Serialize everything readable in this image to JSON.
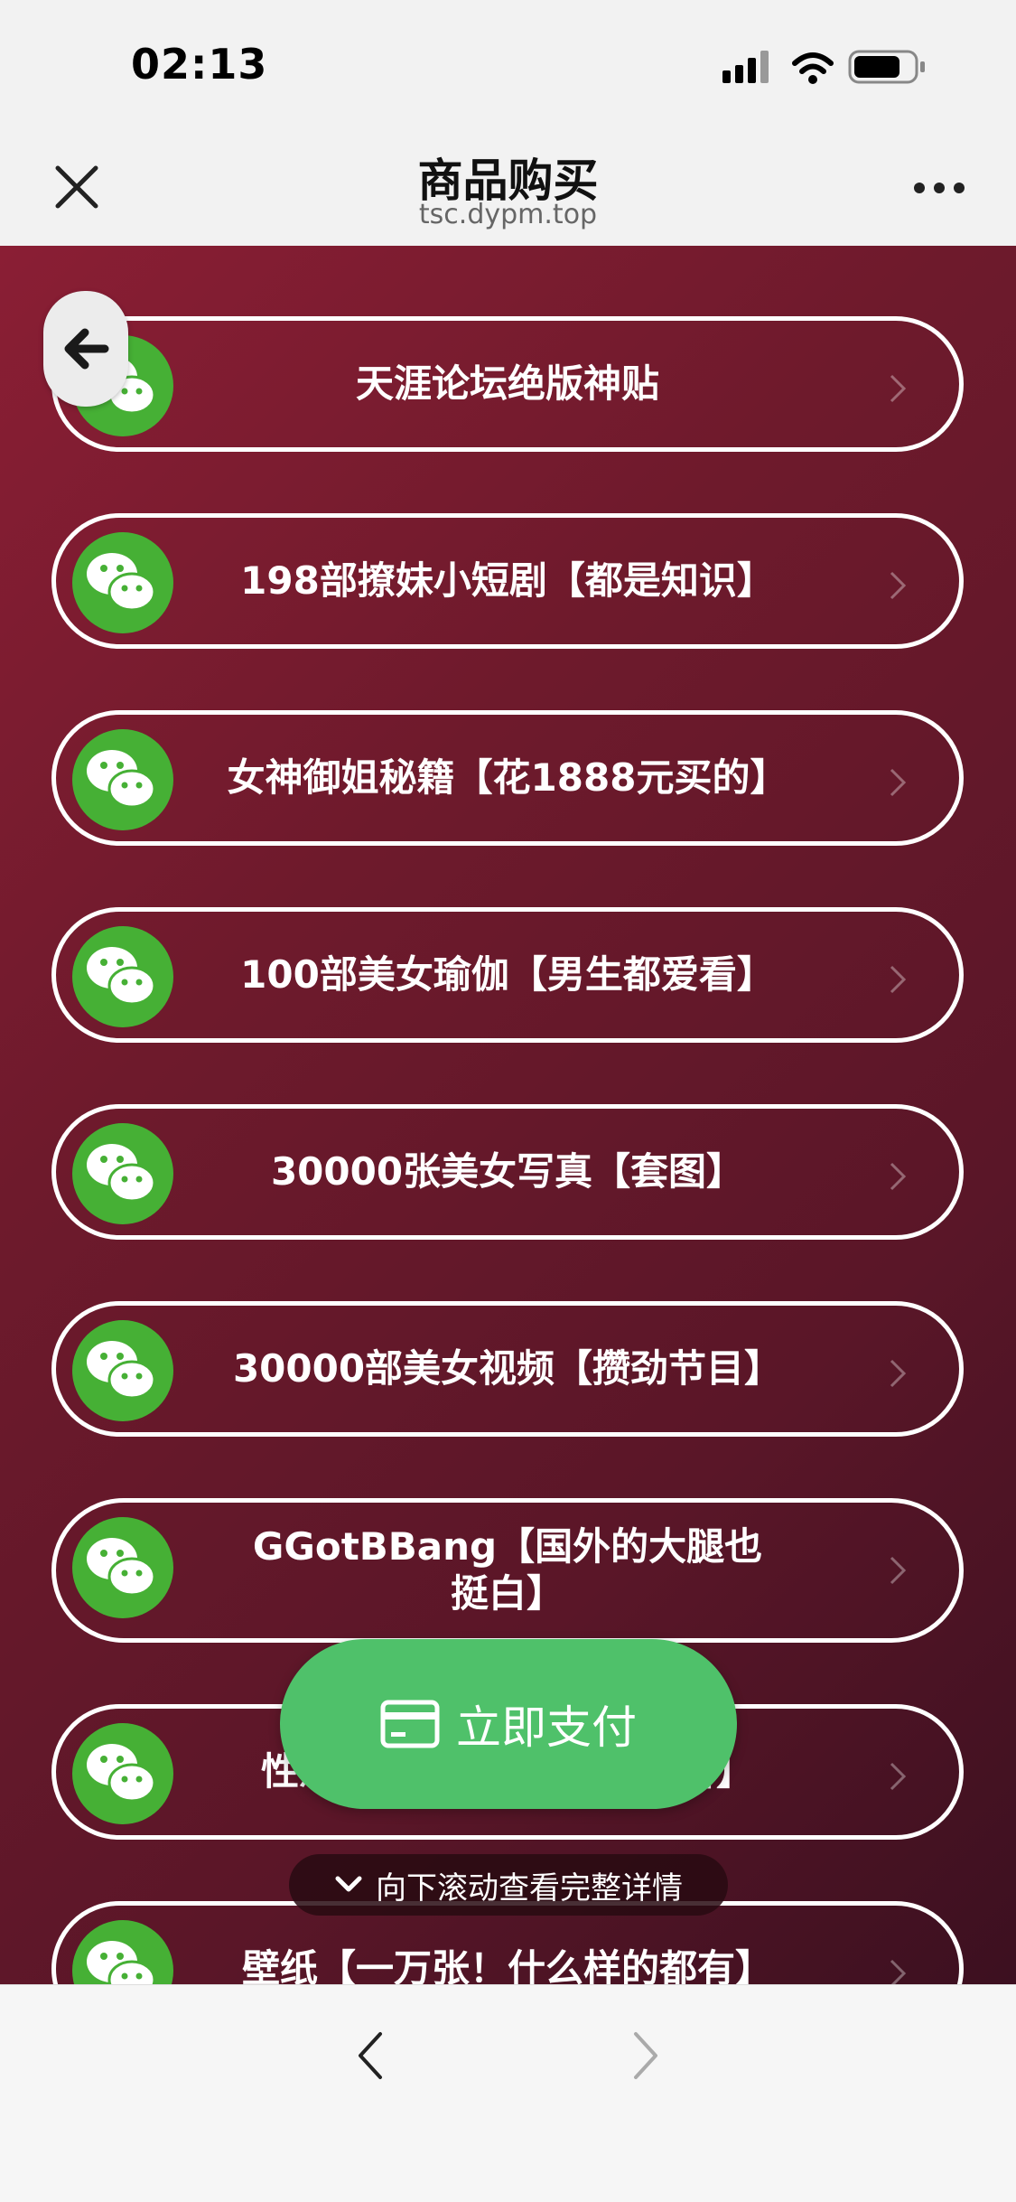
{
  "status_bar": {
    "time": "02:13"
  },
  "nav": {
    "title": "商品购买",
    "url": "tsc.dypm.top"
  },
  "items": [
    {
      "label": "天涯论坛绝版神贴"
    },
    {
      "label": "198部撩妹小短剧【都是知识】"
    },
    {
      "label": "女神御姐秘籍【花1888元买的】"
    },
    {
      "label": "100部美女瑜伽【男生都爱看】"
    },
    {
      "label": "30000张美女写真【套图】"
    },
    {
      "label": "30000部美女视频【攒劲节目】"
    },
    {
      "label": "GGotBBang【国外的大腿也挺白】"
    },
    {
      "label": "性感美女合集【男生都爱看】"
    },
    {
      "label": "壁纸【一万张！什么样的都有】"
    }
  ],
  "pay_button": {
    "label": "立即支付"
  },
  "scroll_hint": {
    "label": "向下滚动查看完整详情"
  },
  "colors": {
    "background_top": "#8a1e34",
    "background_bottom": "#3c1020",
    "pay_green": "#4fc16a",
    "wechat_green": "#46b035"
  },
  "icons": {
    "item_icon": "wechat-icon",
    "back": "arrow-left-icon",
    "pay": "credit-card-icon",
    "hint": "chevron-down-icon"
  }
}
